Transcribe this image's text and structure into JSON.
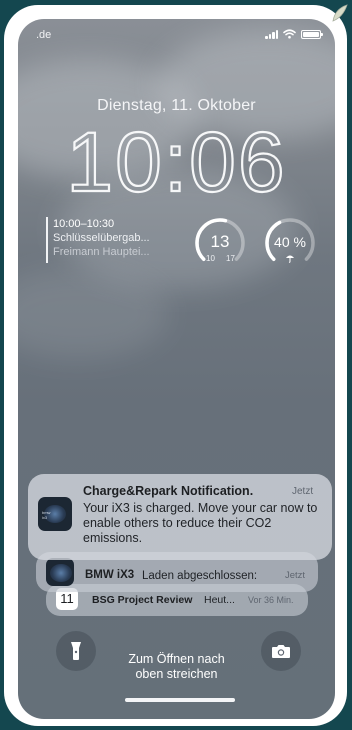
{
  "status_bar": {
    "carrier": ".de",
    "icons": [
      "cellular-signal-icon",
      "wifi-icon",
      "battery-icon"
    ]
  },
  "lock_screen": {
    "date": "Dienstag, 11. Oktober",
    "time": "10:06"
  },
  "widgets": {
    "calendar": {
      "time_range": "10:00–10:30",
      "title": "Schlüsselübergab...",
      "location": "Freimann Hauptei..."
    },
    "temperature": {
      "current": "13",
      "low": "10",
      "high": "17",
      "ring_fraction": 0.55
    },
    "humidity": {
      "value": "40 %",
      "icon": "umbrella-icon",
      "ring_fraction": 0.4
    }
  },
  "notifications": [
    {
      "app_icon": "charge-repark-app-icon",
      "title": "Charge&Repark Notification.",
      "time": "Jetzt",
      "body": "Your iX3 is charged. Move your car now to enable others to reduce their CO2 emissions."
    },
    {
      "app_icon": "bmw-app-icon",
      "title": "BMW iX3",
      "body": "Laden abgeschlossen:",
      "time": "Jetzt"
    },
    {
      "app_icon": "calendar-app-icon",
      "icon_number": "11",
      "title": "BSG Project Review",
      "body": "Heut...",
      "time": "Vor 36 Min."
    }
  ],
  "bottom": {
    "left_icon": "flashlight-icon",
    "right_icon": "camera-icon",
    "hint_line1": "Zum Öffnen nach",
    "hint_line2": "oben streichen"
  },
  "colors": {
    "background_outer": "#14474f",
    "frame": "#ffffff",
    "screen_top": "#8a8f96",
    "screen_bottom": "#657079"
  }
}
